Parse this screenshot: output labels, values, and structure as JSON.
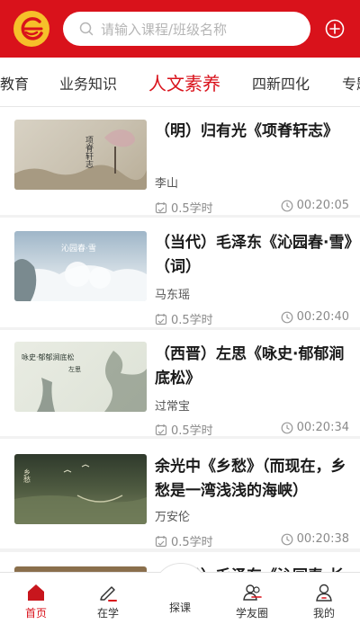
{
  "search": {
    "placeholder": "请输入课程/班级名称"
  },
  "tabs": [
    "教育",
    "业务知识",
    "人文素养",
    "四新四化",
    "专题"
  ],
  "active_tab_index": 2,
  "courses": [
    {
      "title": "（明）归有光《项脊轩志》",
      "teacher": "李山",
      "hours": "0.5学时",
      "duration": "00:20:05",
      "thumb_caption": "项脊轩志"
    },
    {
      "title": "（当代）毛泽东《沁园春·雪》（词）",
      "teacher": "马东瑶",
      "hours": "0.5学时",
      "duration": "00:20:40",
      "thumb_caption": "沁园春·雪"
    },
    {
      "title": "（西晋）左思《咏史·郁郁涧底松》",
      "teacher": "过常宝",
      "hours": "0.5学时",
      "duration": "00:20:34",
      "thumb_caption": "咏史·郁郁涧底松",
      "thumb_caption2": "左思"
    },
    {
      "title": "余光中《乡愁》（而现在，乡愁是一湾浅浅的海峡）",
      "teacher": "万安伦",
      "hours": "0.5学时",
      "duration": "00:20:38",
      "thumb_caption": "乡愁"
    },
    {
      "title": "（当代）毛泽东《沁园春·长沙》（词）"
    }
  ],
  "nav": [
    {
      "label": "首页",
      "icon": "home-icon",
      "active": true
    },
    {
      "label": "在学",
      "icon": "pen-icon",
      "active": false
    },
    {
      "label": "探课",
      "icon": "play-circle-icon",
      "active": false
    },
    {
      "label": "学友圈",
      "icon": "friends-icon",
      "active": false
    },
    {
      "label": "我的",
      "icon": "user-icon",
      "active": false
    }
  ],
  "colors": {
    "brand": "#d9121b",
    "logo": "#f6c02a"
  }
}
